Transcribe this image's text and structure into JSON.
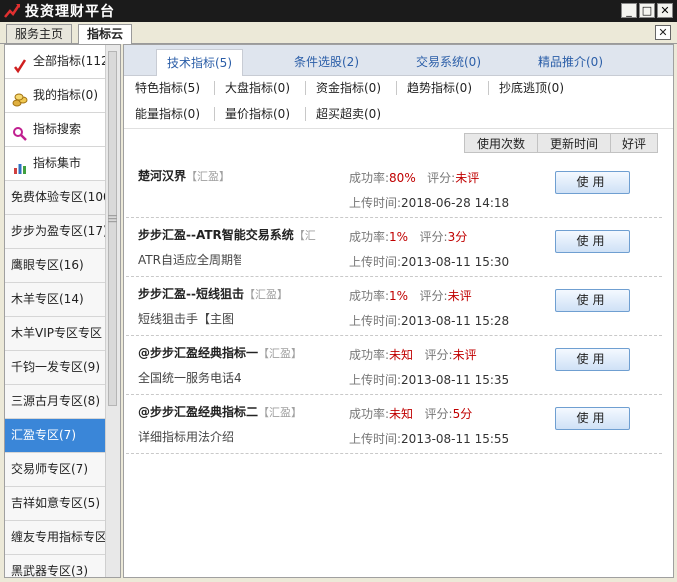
{
  "window": {
    "title": "投资理财平台",
    "min": "_",
    "max": "□",
    "close": "✕"
  },
  "top_tabs": [
    "服务主页",
    "指标云"
  ],
  "panel_close": "✕",
  "sidebar": {
    "icon_items": [
      {
        "label": "全部指标(112",
        "icon": "check-icon"
      },
      {
        "label": "我的指标(0)",
        "icon": "coins-icon"
      },
      {
        "label": "指标搜索",
        "icon": "search-icon"
      },
      {
        "label": "指标集市",
        "icon": "bar-chart-icon"
      }
    ],
    "zones": [
      "免费体验专区(100",
      "步步为盈专区(17)",
      "鹰眼专区(16)",
      "木羊专区(14)",
      "木羊VIP专区专区",
      "千钧一发专区(9)",
      "三源古月专区(8)",
      "汇盈专区(7)",
      "交易师专区(7)",
      "吉祥如意专区(5)",
      "缠友专用指标专区",
      "黑武器专区(3)"
    ],
    "active_zone": "汇盈专区(7)"
  },
  "category_tabs": [
    "技术指标(5)",
    "条件选股(2)",
    "交易系统(0)",
    "精品推介(0)"
  ],
  "subcategories": [
    [
      "特色指标(5)",
      "大盘指标(0)",
      "资金指标(0)",
      "趋势指标(0)",
      "抄底逃顶(0)"
    ],
    [
      "能量指标(0)",
      "量价指标(0)",
      "超买超卖(0)"
    ]
  ],
  "sort_buttons": [
    "使用次数",
    "更新时间",
    "好评"
  ],
  "labels": {
    "win_rate": "成功率:",
    "rating": "评分:",
    "upload_time": "上传时间:",
    "use": "使用"
  },
  "indicators": [
    {
      "name": "楚河汉界",
      "tag": "【汇盈】",
      "desc": "",
      "win_rate": "80%",
      "rating": "未评",
      "upload_time": "2018-06-28 14:18"
    },
    {
      "name": "步步汇盈--ATR智能交易系统",
      "tag": "【汇",
      "desc": "ATR自适应全周期智",
      "win_rate": "1%",
      "rating": "3分",
      "upload_time": "2013-08-11 15:30"
    },
    {
      "name": "步步汇盈--短线狙击",
      "tag": "【汇盈】",
      "desc": "短线狙击手【主图",
      "win_rate": "1%",
      "rating": "未评",
      "upload_time": "2013-08-11 15:28"
    },
    {
      "name": "@步步汇盈经典指标一",
      "tag": "【汇盈】",
      "desc": "全国统一服务电话4",
      "win_rate": "未知",
      "rating": "未评",
      "upload_time": "2013-08-11 15:35"
    },
    {
      "name": "@步步汇盈经典指标二",
      "tag": "【汇盈】",
      "desc": "详细指标用法介绍",
      "win_rate": "未知",
      "rating": "5分",
      "upload_time": "2013-08-11 15:55"
    }
  ],
  "colors": {
    "titlebar": "#1b1b1b",
    "active_zone": "#3a86d8",
    "tab_text": "#2b5ea8",
    "value_red": "#c00000"
  }
}
